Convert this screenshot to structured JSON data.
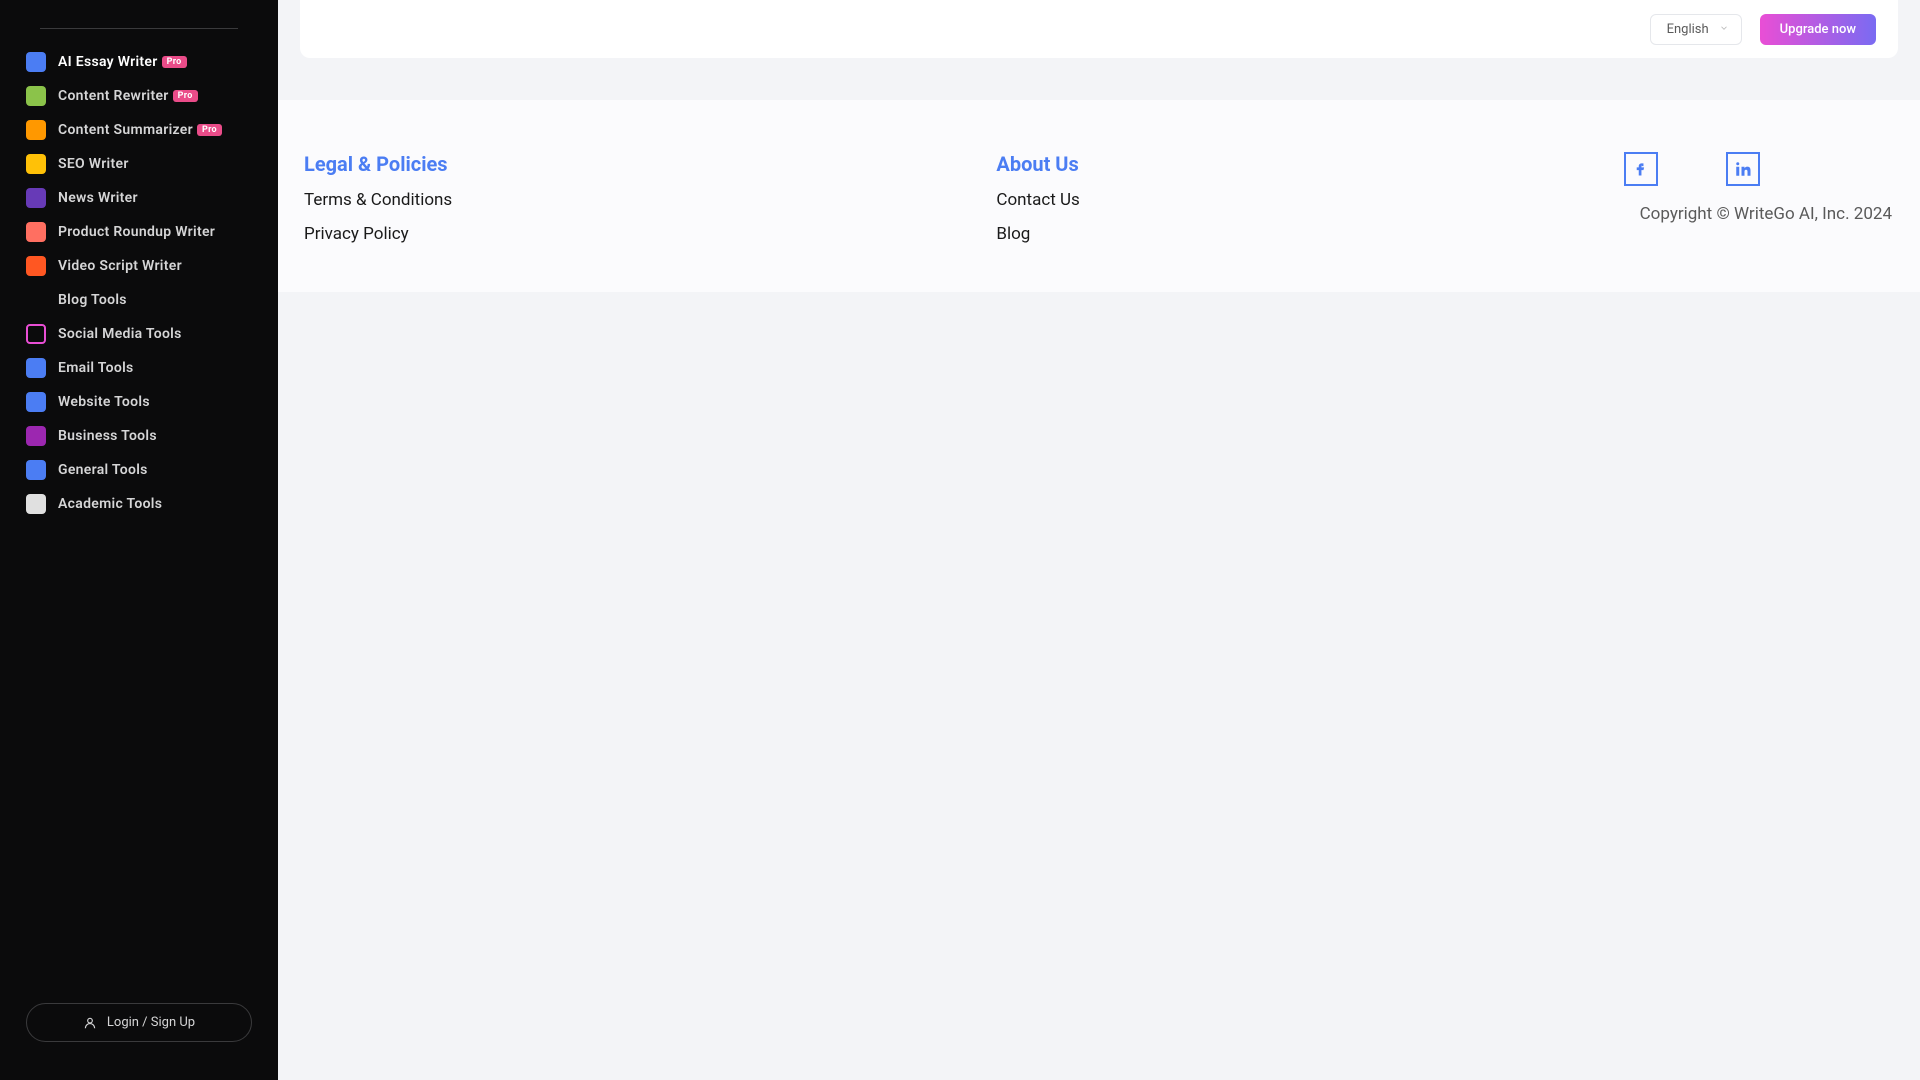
{
  "sidebar": {
    "items": [
      {
        "label": "AI Essay Writer",
        "pro": true,
        "icon": "essay-icon",
        "iconClass": "ic-essay",
        "active": true
      },
      {
        "label": "Content Rewriter",
        "pro": true,
        "icon": "rewriter-icon",
        "iconClass": "ic-rewriter",
        "active": false
      },
      {
        "label": "Content Summarizer",
        "pro": true,
        "icon": "summarizer-icon",
        "iconClass": "ic-summarizer",
        "active": false
      },
      {
        "label": "SEO Writer",
        "pro": false,
        "icon": "seo-icon",
        "iconClass": "ic-seo",
        "active": false
      },
      {
        "label": "News Writer",
        "pro": false,
        "icon": "news-icon",
        "iconClass": "ic-news",
        "active": false
      },
      {
        "label": "Product Roundup Writer",
        "pro": false,
        "icon": "product-icon",
        "iconClass": "ic-product",
        "active": false
      },
      {
        "label": "Video Script Writer",
        "pro": false,
        "icon": "video-icon",
        "iconClass": "ic-video",
        "active": false
      },
      {
        "label": "Blog Tools",
        "pro": false,
        "icon": "blog-icon",
        "iconClass": "ic-blog",
        "active": false
      },
      {
        "label": "Social Media Tools",
        "pro": false,
        "icon": "social-icon",
        "iconClass": "ic-social",
        "active": false
      },
      {
        "label": "Email Tools",
        "pro": false,
        "icon": "email-icon",
        "iconClass": "ic-email",
        "active": false
      },
      {
        "label": "Website Tools",
        "pro": false,
        "icon": "website-icon",
        "iconClass": "ic-website",
        "active": false
      },
      {
        "label": "Business Tools",
        "pro": false,
        "icon": "business-icon",
        "iconClass": "ic-business",
        "active": false
      },
      {
        "label": "General Tools",
        "pro": false,
        "icon": "general-icon",
        "iconClass": "ic-general",
        "active": false
      },
      {
        "label": "Academic Tools",
        "pro": false,
        "icon": "academic-icon",
        "iconClass": "ic-academic",
        "active": false
      }
    ],
    "pro_badge_text": "Pro",
    "login_label": "Login / Sign Up"
  },
  "header": {
    "language_selected": "English",
    "upgrade_label": "Upgrade now"
  },
  "footer": {
    "legal": {
      "heading": "Legal & Policies",
      "links": [
        {
          "label": "Terms & Conditions"
        },
        {
          "label": "Privacy Policy"
        }
      ]
    },
    "about": {
      "heading": "About Us",
      "links": [
        {
          "label": "Contact Us"
        },
        {
          "label": "Blog"
        }
      ]
    },
    "copyright": "Copyright © WriteGo AI, Inc. 2024"
  }
}
